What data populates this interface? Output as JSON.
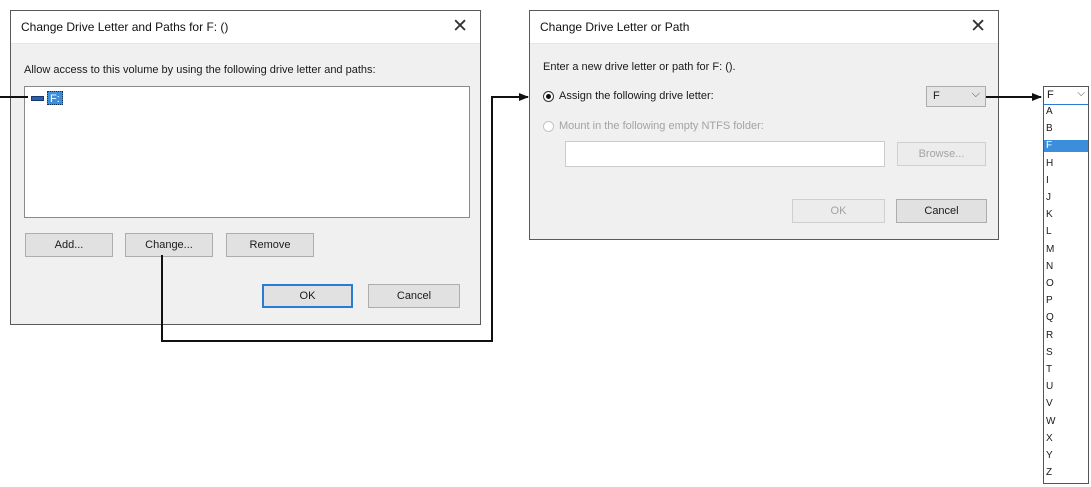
{
  "dialog1": {
    "title": "Change Drive Letter and Paths for F: ()",
    "close_glyph": "✕",
    "instruction": "Allow access to this volume by using the following drive letter and paths:",
    "list_entry": "F:",
    "buttons": {
      "add": "Add...",
      "change": "Change...",
      "remove": "Remove",
      "ok": "OK",
      "cancel": "Cancel"
    }
  },
  "dialog2": {
    "title": "Change Drive Letter or Path",
    "close_glyph": "✕",
    "instruction": "Enter a new drive letter or path for F: ().",
    "assign_label": "Assign the following drive letter:",
    "selected_letter": "F",
    "chevron_glyph": "⌵",
    "mount_label": "Mount in the following empty NTFS folder:",
    "buttons": {
      "browse": "Browse...",
      "ok": "OK",
      "cancel": "Cancel"
    }
  },
  "letter_dropdown": {
    "selected": "F",
    "chevron_glyph": "⌵",
    "options": [
      "A",
      "B",
      "F",
      "H",
      "I",
      "J",
      "K",
      "L",
      "M",
      "N",
      "O",
      "P",
      "Q",
      "R",
      "S",
      "T",
      "U",
      "V",
      "W",
      "X",
      "Y",
      "Z"
    ]
  },
  "colors": {
    "selection": "#3b8edc",
    "default_button_border": "#2a7bd6",
    "arrow": "#111111"
  }
}
